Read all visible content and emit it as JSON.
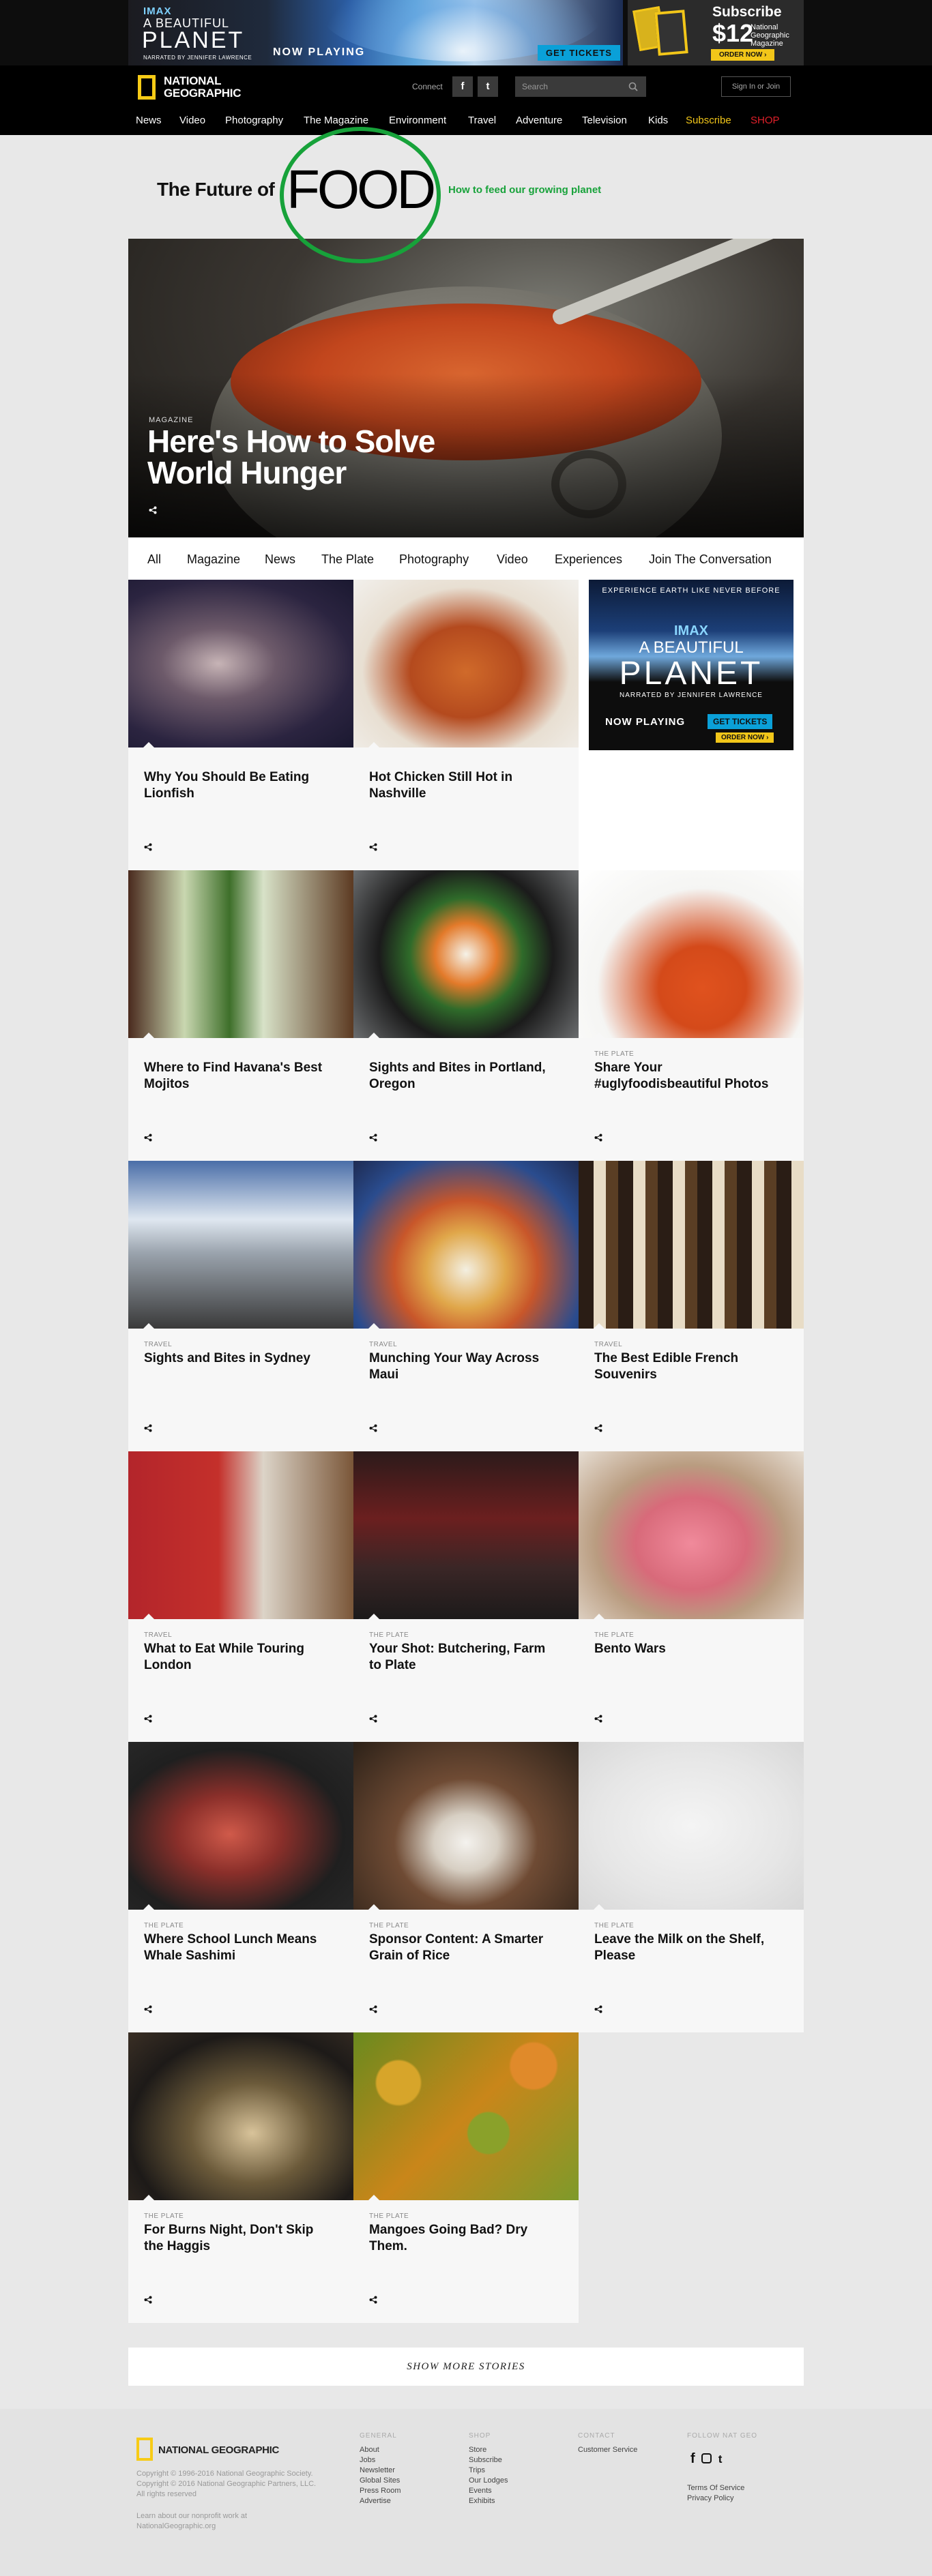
{
  "colors": {
    "accent_yellow": "#f7cb16",
    "food_green": "#17a23a",
    "shop_red": "#e0202a",
    "subscribe_gold": "#f2c619"
  },
  "ad_banner": {
    "imax": "IMAX",
    "a_beautiful": "A BEAUTIFUL",
    "planet": "PLANET",
    "narrated": "NARRATED BY JENNIFER LAWRENCE",
    "now_playing": "NOW PLAYING",
    "get_tickets": "GET TICKETS"
  },
  "ad_subscribe": {
    "subscribe": "Subscribe",
    "price": "$12",
    "publication": "National Geographic Magazine",
    "order_now": "ORDER NOW ›"
  },
  "header": {
    "brand_line1": "NATIONAL",
    "brand_line2": "GEOGRAPHIC",
    "connect": "Connect",
    "facebook_icon": "f",
    "twitter_icon": "t",
    "search_placeholder": "Search",
    "sign_in": "Sign In or Join"
  },
  "nav": {
    "items": [
      "News",
      "Video",
      "Photography",
      "The Magazine",
      "Environment",
      "Travel",
      "Adventure",
      "Television",
      "Kids",
      "Subscribe",
      "SHOP"
    ]
  },
  "food_header": {
    "future": "The Future of",
    "food": "FOOD",
    "tagline": "How to feed our growing planet"
  },
  "hero": {
    "kicker": "MAGAZINE",
    "headline": "Here's How to Solve World Hunger"
  },
  "subnav": {
    "tabs": [
      "All",
      "Magazine",
      "News",
      "The Plate",
      "Photography",
      "Video",
      "Experiences",
      "Join The Conversation"
    ]
  },
  "ad_card": {
    "experience": "EXPERIENCE EARTH LIKE NEVER BEFORE",
    "imax": "IMAX",
    "a_beautiful": "A BEAUTIFUL",
    "planet": "PLANET",
    "narrated": "NARRATED BY JENNIFER LAWRENCE",
    "now_playing": "NOW PLAYING",
    "get_tickets": "GET TICKETS",
    "order_now": "ORDER NOW ›"
  },
  "cards": [
    {
      "category": "",
      "title": "Why You Should Be Eating Lionfish",
      "image": "lionfish"
    },
    {
      "category": "",
      "title": "Hot Chicken Still Hot in Nashville",
      "image": "hot-chicken"
    },
    {
      "category": "",
      "title": "Where to Find Havana's Best Mojitos",
      "image": "mojitos"
    },
    {
      "category": "",
      "title": "Sights and Bites in Portland, Oregon",
      "image": "bibimbap"
    },
    {
      "category": "THE PLATE",
      "title": "Share Your #uglyfoodisbeautiful Photos",
      "image": "carrots"
    },
    {
      "category": "TRAVEL",
      "title": "Sights and Bites in Sydney",
      "image": "sydney"
    },
    {
      "category": "TRAVEL",
      "title": "Munching Your Way Across Maui",
      "image": "maui-salad"
    },
    {
      "category": "TRAVEL",
      "title": "The Best Edible French Souvenirs",
      "image": "french-shelves"
    },
    {
      "category": "TRAVEL",
      "title": "What to Eat While Touring London",
      "image": "london-cafe"
    },
    {
      "category": "THE PLATE",
      "title": "Your Shot: Butchering, Farm to Plate",
      "image": "butcher"
    },
    {
      "category": "THE PLATE",
      "title": "Bento Wars",
      "image": "bento"
    },
    {
      "category": "THE PLATE",
      "title": "Where School Lunch Means Whale Sashimi",
      "image": "sashimi"
    },
    {
      "category": "THE PLATE",
      "title": "Sponsor Content: A Smarter Grain of Rice",
      "image": "rice-hands"
    },
    {
      "category": "THE PLATE",
      "title": "Leave the Milk on the Shelf, Please",
      "image": "snow-umbrella"
    },
    {
      "category": "THE PLATE",
      "title": "For Burns Night, Don't Skip the Haggis",
      "image": "haggis"
    },
    {
      "category": "THE PLATE",
      "title": "Mangoes Going Bad? Dry Them.",
      "image": "mangoes"
    }
  ],
  "show_more": "SHOW MORE STORIES",
  "footer": {
    "brand": "NATIONAL GEOGRAPHIC",
    "copyright1": "Copyright © 1996-2016 National Geographic Society.",
    "copyright2": "Copyright © 2016 National Geographic Partners, LLC.",
    "rights": "All rights reserved",
    "learn": "Learn about our nonprofit work at NationalGeographic.org",
    "general": {
      "heading": "GENERAL",
      "links": [
        "About",
        "Jobs",
        "Newsletter",
        "Global Sites",
        "Press Room",
        "Advertise"
      ]
    },
    "shop": {
      "heading": "SHOP",
      "links": [
        "Store",
        "Subscribe",
        "Trips",
        "Our Lodges",
        "Events",
        "Exhibits"
      ]
    },
    "contact": {
      "heading": "CONTACT",
      "links": [
        "Customer Service"
      ]
    },
    "follow": {
      "heading": "FOLLOW NAT GEO",
      "links": [
        "Terms Of Service",
        "Privacy Policy"
      ]
    }
  }
}
